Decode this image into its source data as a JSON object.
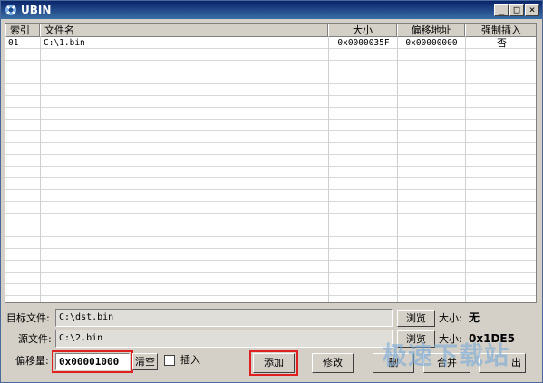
{
  "window": {
    "title": "UBIN"
  },
  "titlebar_buttons": {
    "minimize": "_",
    "maximize": "□",
    "close": "×"
  },
  "table": {
    "columns": [
      "索引",
      "文件名",
      "大小",
      "偏移地址",
      "强制插入"
    ],
    "rows": [
      {
        "index": "01",
        "filename": "C:\\1.bin",
        "size": "0x0000035F",
        "offset": "0x00000000",
        "force_insert": "否"
      }
    ]
  },
  "target": {
    "label": "目标文件:",
    "value": "C:\\dst.bin",
    "browse_label": "浏览",
    "size_label": "大小:",
    "size_value": "无"
  },
  "source": {
    "label": "源文件:",
    "value": "C:\\2.bin",
    "browse_label": "浏览",
    "size_label": "大小:",
    "size_value": "0x1DE5"
  },
  "offset": {
    "label": "偏移量:",
    "value": "0x00001000",
    "clear_label": "清空",
    "insert_label": "插入",
    "insert_checked": false
  },
  "actions": {
    "add_label": "添加",
    "modify_label": "修改",
    "delete_label": "删",
    "merge_label": "合并",
    "exit_label": "出"
  },
  "watermark": {
    "text": "极速下载站"
  },
  "colors": {
    "titlebar": "#0a246a",
    "highlight": "#e02020"
  }
}
